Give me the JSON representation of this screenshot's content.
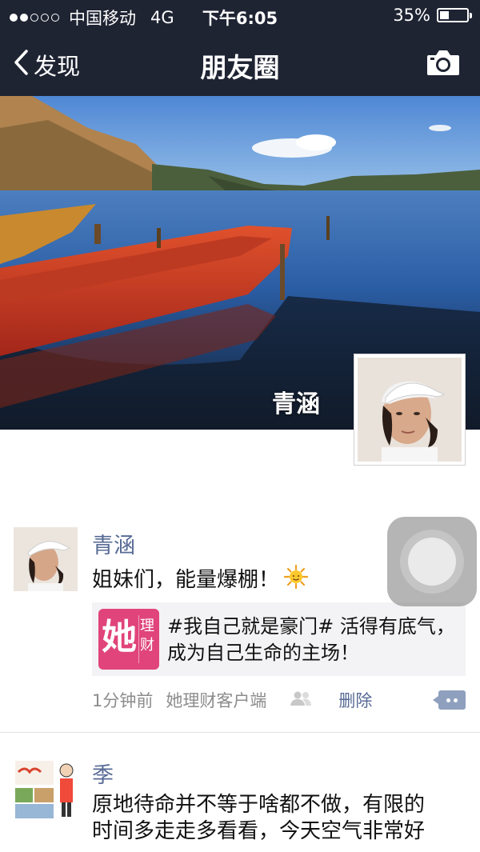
{
  "status_bar": {
    "carrier": "中国移动",
    "network": "4G",
    "time": "下午6:05",
    "battery": "35%",
    "battery_level": 0.35,
    "signal_dots_on": 2,
    "signal_dots_total": 5
  },
  "nav": {
    "back_label": "发现",
    "title": "朋友圈",
    "camera_icon": "camera-icon"
  },
  "cover": {
    "owner_name": "青涵"
  },
  "posts": [
    {
      "author": "青涵",
      "text": "姐妹们，能量爆棚！",
      "emoji": "sun-emoji",
      "share": {
        "logo_big": "她",
        "logo_small_1": "理",
        "logo_small_2": "财",
        "text": "#我自己就是豪门# 活得有底气，成为自己生命的主场！"
      },
      "time": "1分钟前",
      "source": "她理财客户端",
      "delete_label": "删除"
    },
    {
      "author": "季",
      "text_line1": "原地待命并不等于啥都不做，有限的",
      "text_line2": "时间多走走多看看，今天空气非常好"
    }
  ],
  "colors": {
    "nav_bg": "#1f2433",
    "link": "#576b95",
    "logo_pink": "#e0447a",
    "share_bg": "#f3f3f5"
  }
}
